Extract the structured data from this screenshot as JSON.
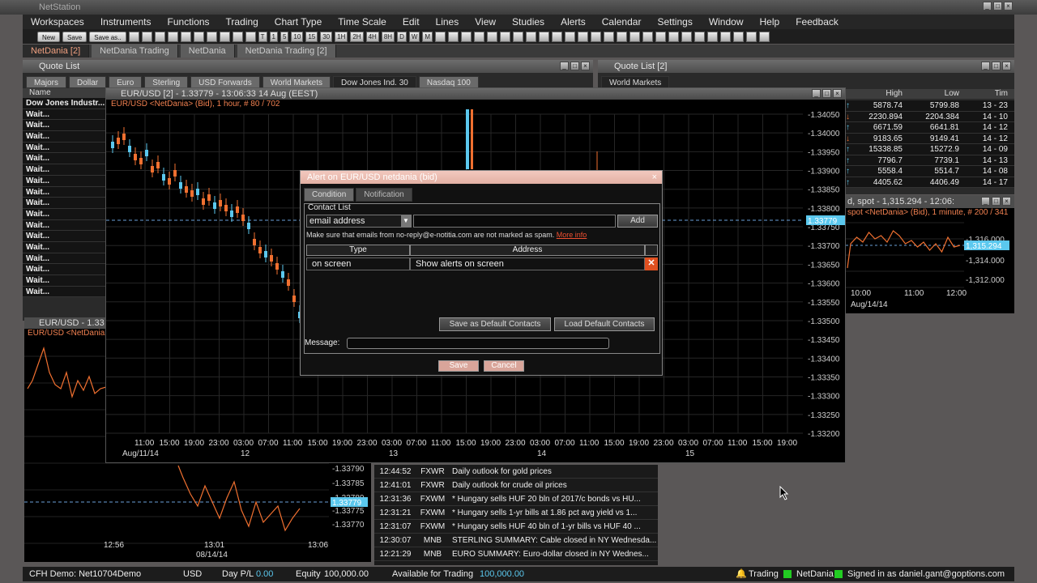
{
  "app": {
    "title": "NetStation"
  },
  "menu": [
    "Workspaces",
    "Instruments",
    "Functions",
    "Trading",
    "Chart Type",
    "Time Scale",
    "Edit",
    "Lines",
    "View",
    "Studies",
    "Alerts",
    "Calendar",
    "Settings",
    "Window",
    "Help",
    "Feedback"
  ],
  "toolbar": {
    "new_label": "New",
    "save_label": "Save",
    "saveas_label": "Save as..",
    "timeframes": [
      "T",
      "1",
      "5",
      "10",
      "15",
      "30",
      "1H",
      "2H",
      "4H",
      "8H",
      "D",
      "W",
      "M"
    ]
  },
  "workspace_tabs": [
    "NetDania [2]",
    "NetDania Trading",
    "NetDania",
    "NetDania Trading [2]"
  ],
  "quote_list": {
    "title": "Quote List",
    "tabs": [
      "Majors",
      "Dollar",
      "Euro",
      "Sterling",
      "USD Forwards",
      "World Markets",
      "Dow Jones Ind. 30",
      "Nasdaq 100"
    ],
    "col_name": "Name",
    "rows": [
      "Dow Jones Industr...",
      "Wait...",
      "Wait...",
      "Wait...",
      "Wait...",
      "Wait...",
      "Wait...",
      "Wait...",
      "Wait...",
      "Wait...",
      "Wait...",
      "Wait...",
      "Wait...",
      "Wait...",
      "Wait...",
      "Wait...",
      "Wait...",
      "Wait..."
    ]
  },
  "quote_list2": {
    "title": "Quote List [2]",
    "tab": "World Markets",
    "cols": [
      "High",
      "Low",
      "Tim"
    ],
    "rows": [
      {
        "dir": "up",
        "high": "5878.74",
        "low": "5799.88",
        "time": "13 - 23"
      },
      {
        "dir": "down",
        "high": "2230.894",
        "low": "2204.384",
        "time": "14 - 10"
      },
      {
        "dir": "up",
        "high": "6671.59",
        "low": "6641.81",
        "time": "14 - 12"
      },
      {
        "dir": "down",
        "high": "9183.65",
        "low": "9149.41",
        "time": "14 - 12"
      },
      {
        "dir": "up",
        "high": "15338.85",
        "low": "15272.9",
        "time": "14 - 09"
      },
      {
        "dir": "up",
        "high": "7796.7",
        "low": "7739.1",
        "time": "14 - 13"
      },
      {
        "dir": "up",
        "high": "5558.4",
        "low": "5514.7",
        "time": "14 - 08"
      },
      {
        "dir": "up",
        "high": "4405.62",
        "low": "4406.49",
        "time": "14 - 17"
      }
    ]
  },
  "main_chart": {
    "window_title": "EUR/USD [2] - 1.33779 - 13:06:33  14 Aug (EEST)",
    "subtitle": "EUR/USD <NetDania> (Bid), 1 hour, # 80 / 702",
    "last_price": "1.33779",
    "y_ticks": [
      "1.34050",
      "1.34000",
      "1.33950",
      "1.33900",
      "1.33850",
      "1.33800",
      "1.33750",
      "1.33700",
      "1.33650",
      "1.33600",
      "1.33550",
      "1.33500",
      "1.33450",
      "1.33400",
      "1.33350",
      "1.33300",
      "1.33250",
      "1.33200"
    ],
    "x_ticks": [
      "11:00",
      "15:00",
      "19:00",
      "23:00",
      "03:00",
      "07:00",
      "11:00",
      "15:00",
      "19:00",
      "23:00",
      "03:00",
      "07:00",
      "11:00",
      "15:00",
      "19:00",
      "23:00",
      "03:00",
      "07:00",
      "11:00",
      "15:00",
      "19:00",
      "23:00",
      "03:00",
      "07:00",
      "11:00",
      "15:00",
      "19:00"
    ],
    "date_labels": [
      "Aug/11/14",
      "12",
      "13",
      "14",
      "15"
    ]
  },
  "alert_dialog": {
    "title": "Alert on EUR/USD netdania (bid)",
    "tabs": [
      "Condition",
      "Notification"
    ],
    "section": "Contact List",
    "select_value": "email address",
    "add_label": "Add",
    "note": "Make sure that emails from no-reply@e-notitia.com are not marked as spam.",
    "more_info": "More info",
    "col_type": "Type",
    "col_address": "Address",
    "row_type": "on screen",
    "row_address": "Show alerts on screen",
    "save_default": "Save as Default Contacts",
    "load_default": "Load Default Contacts",
    "message_label": "Message:",
    "save_label": "Save",
    "cancel_label": "Cancel"
  },
  "small_chart": {
    "title": "EUR/USD - 1.33",
    "subtitle": "EUR/USD <NetDania>",
    "y_ticks": [
      "1.33790",
      "1.33785",
      "1.33780",
      "1.33775",
      "1.33770"
    ],
    "last_price": "1.33779",
    "x_ticks": [
      "12:56",
      "13:01",
      "13:06"
    ],
    "date": "08/14/14"
  },
  "right_chart": {
    "title": "d, spot - 1,315.294 - 12:06:",
    "subtitle": "spot <NetDania> (Bid), 1 minute, # 200 / 341",
    "y_ticks": [
      "1,316.000",
      "1,314.000",
      "1,312.000"
    ],
    "last_price": "1,315.294",
    "x_ticks": [
      "10:00",
      "11:00",
      "12:00"
    ],
    "date": "Aug/14/14"
  },
  "news": [
    {
      "time": "12:44:52",
      "src": "FXWR",
      "headline": "Daily outlook for gold prices"
    },
    {
      "time": "12:41:01",
      "src": "FXWR",
      "headline": "Daily outlook for crude oil prices"
    },
    {
      "time": "12:31:36",
      "src": "FXWM",
      "headline": "* Hungary sells HUF 20 bln of 2017/c bonds vs HU..."
    },
    {
      "time": "12:31:21",
      "src": "FXWM",
      "headline": "* Hungary sells 1-yr bills at 1.86 pct avg yield vs 1..."
    },
    {
      "time": "12:31:07",
      "src": "FXWM",
      "headline": "* Hungary sells HUF 40 bln of 1-yr bills vs HUF 40 ..."
    },
    {
      "time": "12:30:07",
      "src": "MNB",
      "headline": "STERLING SUMMARY: Cable closed in NY Wednesda..."
    },
    {
      "time": "12:21:29",
      "src": "MNB",
      "headline": "EURO SUMMARY: Euro-dollar closed in NY Wednes..."
    }
  ],
  "status": {
    "account": "CFH Demo: Net10704Demo",
    "currency": "USD",
    "day_pl_label": "Day P/L",
    "day_pl": "0.00",
    "equity_label": "Equity",
    "equity": "100,000.00",
    "avail_label": "Available for Trading",
    "avail": "100,000.00",
    "trading": "Trading",
    "netdania": "NetDania",
    "signed_in": "Signed in as daniel.gant@goptions.com"
  },
  "colors": {
    "up": "#5bc8ee",
    "down": "#f07030",
    "accent": "#f08050"
  }
}
